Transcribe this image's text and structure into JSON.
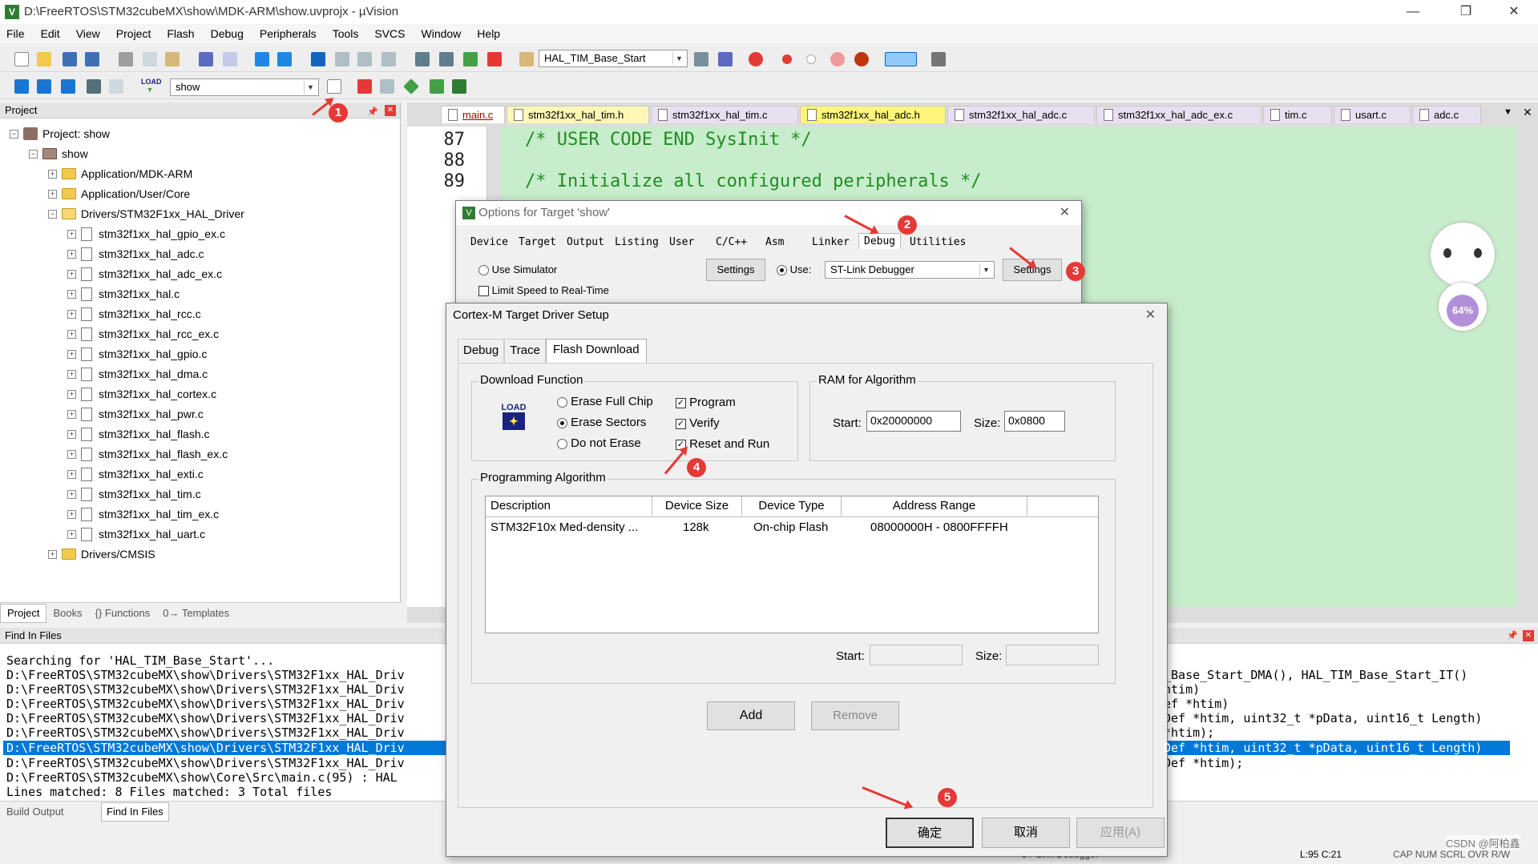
{
  "window": {
    "title": "D:\\FreeRTOS\\STM32cubeMX\\show\\MDK-ARM\\show.uvprojx - µVision",
    "min": "—",
    "max": "❐",
    "close": "✕"
  },
  "menu": [
    "File",
    "Edit",
    "View",
    "Project",
    "Flash",
    "Debug",
    "Peripherals",
    "Tools",
    "SVCS",
    "Window",
    "Help"
  ],
  "toolbar1": {
    "function_combo": "HAL_TIM_Base_Start"
  },
  "toolbar2": {
    "target_combo": "show",
    "load_label": "LOAD"
  },
  "project": {
    "header": "Project",
    "root": "Project: show",
    "target": "show",
    "groups": [
      "Application/MDK-ARM",
      "Application/User/Core",
      "Drivers/STM32F1xx_HAL_Driver"
    ],
    "files": [
      "stm32f1xx_hal_gpio_ex.c",
      "stm32f1xx_hal_adc.c",
      "stm32f1xx_hal_adc_ex.c",
      "stm32f1xx_hal.c",
      "stm32f1xx_hal_rcc.c",
      "stm32f1xx_hal_rcc_ex.c",
      "stm32f1xx_hal_gpio.c",
      "stm32f1xx_hal_dma.c",
      "stm32f1xx_hal_cortex.c",
      "stm32f1xx_hal_pwr.c",
      "stm32f1xx_hal_flash.c",
      "stm32f1xx_hal_flash_ex.c",
      "stm32f1xx_hal_exti.c",
      "stm32f1xx_hal_tim.c",
      "stm32f1xx_hal_tim_ex.c",
      "stm32f1xx_hal_uart.c"
    ],
    "last_group": "Drivers/CMSIS",
    "tabs": [
      "Project",
      "Books",
      "{} Functions",
      "0→ Templates"
    ]
  },
  "editor": {
    "tabs": [
      "main.c",
      "stm32f1xx_hal_tim.h",
      "stm32f1xx_hal_tim.c",
      "stm32f1xx_hal_adc.h",
      "stm32f1xx_hal_adc.c",
      "stm32f1xx_hal_adc_ex.c",
      "tim.c",
      "usart.c",
      "adc.c"
    ],
    "lines": [
      "87",
      "88",
      "89"
    ],
    "code": [
      "/* USER CODE END SysInit */",
      "",
      "/* Initialize all configured peripherals */"
    ],
    "mascot_text": "64%"
  },
  "find": {
    "header": "Find In Files",
    "lines": [
      "Searching for 'HAL_TIM_Base_Start'...",
      "D:\\FreeRTOS\\STM32cubeMX\\show\\Drivers\\STM32F1xx_HAL_Driv",
      "D:\\FreeRTOS\\STM32cubeMX\\show\\Drivers\\STM32F1xx_HAL_Driv",
      "D:\\FreeRTOS\\STM32cubeMX\\show\\Drivers\\STM32F1xx_HAL_Driv",
      "D:\\FreeRTOS\\STM32cubeMX\\show\\Drivers\\STM32F1xx_HAL_Driv",
      "D:\\FreeRTOS\\STM32cubeMX\\show\\Drivers\\STM32F1xx_HAL_Driv",
      "D:\\FreeRTOS\\STM32cubeMX\\show\\Drivers\\STM32F1xx_HAL_Driv",
      "D:\\FreeRTOS\\STM32cubeMX\\show\\Drivers\\STM32F1xx_HAL_Driv",
      "D:\\FreeRTOS\\STM32cubeMX\\show\\Core\\Src\\main.c(95) :  HAL",
      "Lines matched: 8      Files matched: 3      Total files"
    ],
    "right_lines": [
      "",
      "",
      "_Base_Start_DMA(), HAL_TIM_Base_Start_IT()",
      "htim)",
      "ef *htim)",
      "Def *htim, uint32_t *pData, uint16_t Length)",
      "*htim);",
      "Def *htim);",
      "Def *htim, uint32_t *pData, uint16_t Length)"
    ],
    "tabs": [
      "Build Output",
      "Find In Files"
    ]
  },
  "status": {
    "debugger": "ST-Link Debugger",
    "pos": "L:95 C:21",
    "flags": "CAP  NUM  SCRL  OVR  R/W",
    "watermark": "CSDN @阿柏鑫"
  },
  "options_dialog": {
    "title": "Options for Target 'show'",
    "tabs": [
      "Device",
      "Target",
      "Output",
      "Listing",
      "User",
      "C/C++",
      "Asm",
      "Linker",
      "Debug",
      "Utilities"
    ],
    "use_simulator": "Use Simulator",
    "limit_speed": "Limit Speed to Real-Time",
    "settings_left": "Settings",
    "use_label": "Use:",
    "debugger": "ST-Link Debugger",
    "settings_right": "Settings"
  },
  "cortex_dialog": {
    "title": "Cortex-M Target Driver Setup",
    "tabs": [
      "Debug",
      "Trace",
      "Flash Download"
    ],
    "download_function": {
      "label": "Download Function",
      "load_icon": "LOAD",
      "options": [
        "Erase Full Chip",
        "Erase Sectors",
        "Do not Erase"
      ],
      "selected": "Erase Sectors",
      "checks": [
        "Program",
        "Verify",
        "Reset and Run"
      ]
    },
    "ram": {
      "label": "RAM for Algorithm",
      "start_label": "Start:",
      "start": "0x20000000",
      "size_label": "Size:",
      "size": "0x0800"
    },
    "algorithm": {
      "label": "Programming Algorithm",
      "columns": [
        "Description",
        "Device Size",
        "Device Type",
        "Address Range"
      ],
      "rows": [
        [
          "STM32F10x Med-density ...",
          "128k",
          "On-chip Flash",
          "08000000H - 0800FFFFH"
        ]
      ],
      "start_label": "Start:",
      "size_label": "Size:"
    },
    "add": "Add",
    "remove": "Remove",
    "ok": "确定",
    "cancel": "取消",
    "apply": "应用(A)"
  },
  "annotations": [
    "1",
    "2",
    "3",
    "4",
    "5"
  ],
  "colors": {
    "code_bg": "#c7edcc",
    "code_fg": "#238b23",
    "highlight": "#0078d7",
    "annotation": "#e53935"
  }
}
